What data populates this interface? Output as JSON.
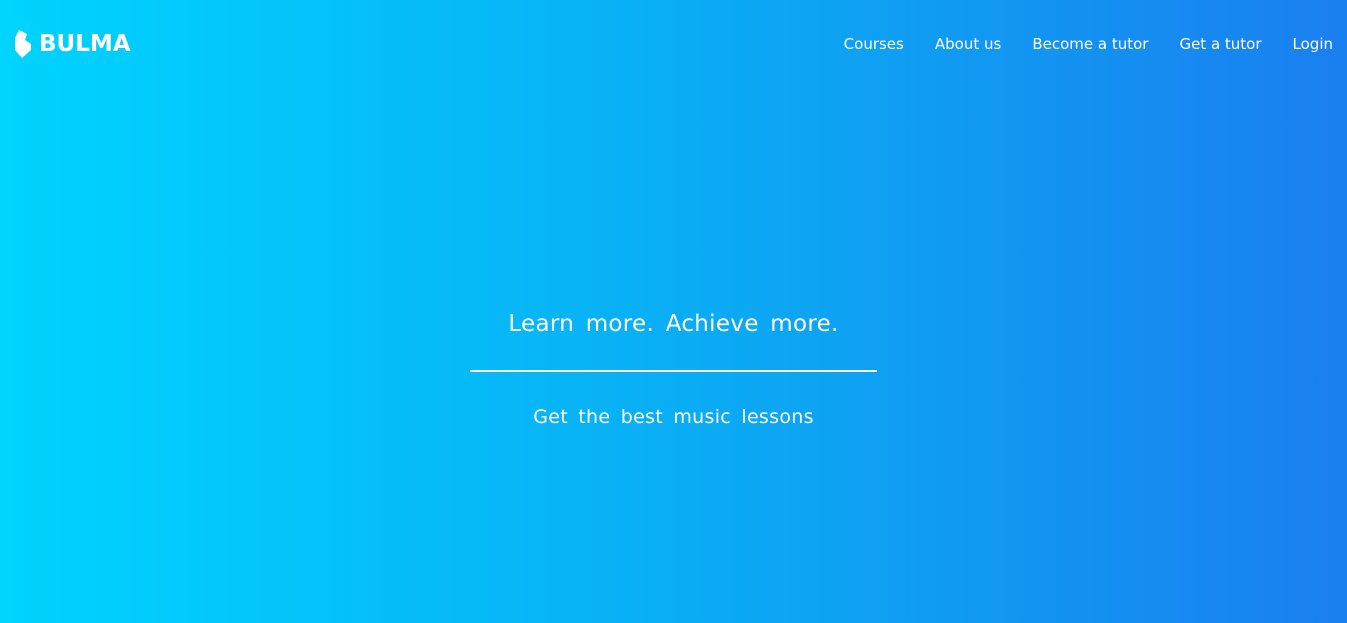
{
  "navbar": {
    "brand": {
      "name": "BULMA",
      "icon": "bulma-logo-icon"
    },
    "items": [
      {
        "label": "Courses"
      },
      {
        "label": "About us"
      },
      {
        "label": "Become a tutor"
      },
      {
        "label": "Get a tutor"
      },
      {
        "label": "Login"
      }
    ]
  },
  "hero": {
    "title": "Learn more. Achieve more.",
    "subtitle": "Get the best music lessons"
  },
  "colors": {
    "gradient_start": "#00d4ff",
    "gradient_end": "#1a7fef",
    "text": "#ffffff"
  }
}
